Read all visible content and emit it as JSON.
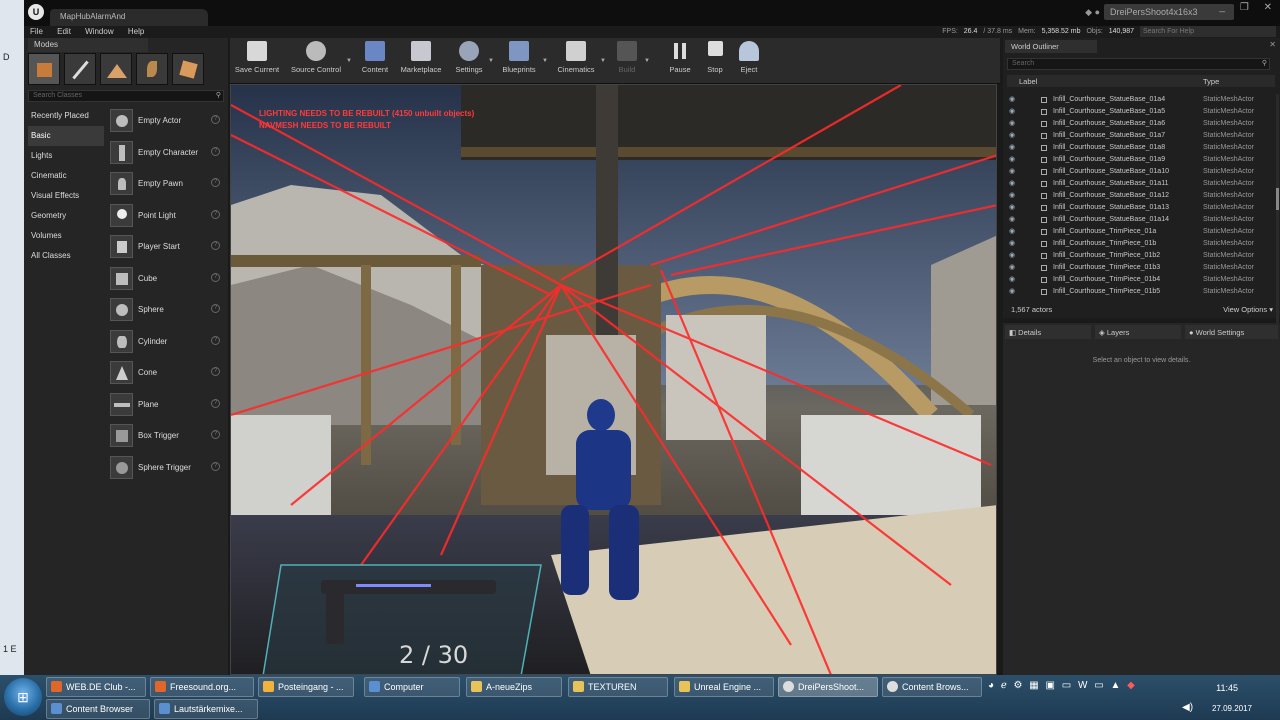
{
  "desktop": {
    "frag_top": "D",
    "frag_bottom": "1 E"
  },
  "window": {
    "logo": "U",
    "map_tab": "MapHubAlarmAnd",
    "project_name": "DreiPersShoot4x16x3",
    "controls": "_ ❐ ✕"
  },
  "menu": {
    "file": "File",
    "edit": "Edit",
    "window": "Window",
    "help": "Help"
  },
  "stats": {
    "fps_label": "FPS:",
    "fps": "26.4",
    "ms": "/ 37.8 ms",
    "mem_label": "Mem:",
    "mem": "5,358.52 mb",
    "objs_label": "Objs:",
    "objs": "140,987",
    "help_search_placeholder": "Search For Help"
  },
  "modes": {
    "tab": "Modes",
    "search_placeholder": "Search Classes",
    "categories": [
      "Recently Placed",
      "Basic",
      "Lights",
      "Cinematic",
      "Visual Effects",
      "Geometry",
      "Volumes",
      "All Classes"
    ],
    "active_category": "Basic",
    "classes": [
      "Empty Actor",
      "Empty Character",
      "Empty Pawn",
      "Point Light",
      "Player Start",
      "Cube",
      "Sphere",
      "Cylinder",
      "Cone",
      "Plane",
      "Box Trigger",
      "Sphere Trigger"
    ]
  },
  "toolbar": {
    "save": "Save Current",
    "source_control": "Source Control",
    "content": "Content",
    "marketplace": "Marketplace",
    "settings": "Settings",
    "blueprints": "Blueprints",
    "cinematics": "Cinematics",
    "build": "Build",
    "pause": "Pause",
    "stop": "Stop",
    "eject": "Eject"
  },
  "viewport": {
    "warning1": "LIGHTING NEEDS TO BE REBUILT (4150 unbuilt objects)",
    "warning2": "NAVMESH NEEDS TO BE REBUILT",
    "ammo": "2 / 30"
  },
  "outliner": {
    "tab": "World Outliner",
    "search_placeholder": "Search",
    "col_label": "Label",
    "col_type": "Type",
    "rows": [
      {
        "name": "Infill_Courthouse_StatueBase_01a4",
        "type": "StaticMeshActor"
      },
      {
        "name": "Infill_Courthouse_StatueBase_01a5",
        "type": "StaticMeshActor"
      },
      {
        "name": "Infill_Courthouse_StatueBase_01a6",
        "type": "StaticMeshActor"
      },
      {
        "name": "Infill_Courthouse_StatueBase_01a7",
        "type": "StaticMeshActor"
      },
      {
        "name": "Infill_Courthouse_StatueBase_01a8",
        "type": "StaticMeshActor"
      },
      {
        "name": "Infill_Courthouse_StatueBase_01a9",
        "type": "StaticMeshActor"
      },
      {
        "name": "Infill_Courthouse_StatueBase_01a10",
        "type": "StaticMeshActor"
      },
      {
        "name": "Infill_Courthouse_StatueBase_01a11",
        "type": "StaticMeshActor"
      },
      {
        "name": "Infill_Courthouse_StatueBase_01a12",
        "type": "StaticMeshActor"
      },
      {
        "name": "Infill_Courthouse_StatueBase_01a13",
        "type": "StaticMeshActor"
      },
      {
        "name": "Infill_Courthouse_StatueBase_01a14",
        "type": "StaticMeshActor"
      },
      {
        "name": "Infill_Courthouse_TrimPiece_01a",
        "type": "StaticMeshActor"
      },
      {
        "name": "Infill_Courthouse_TrimPiece_01b",
        "type": "StaticMeshActor"
      },
      {
        "name": "Infill_Courthouse_TrimPiece_01b2",
        "type": "StaticMeshActor"
      },
      {
        "name": "Infill_Courthouse_TrimPiece_01b3",
        "type": "StaticMeshActor"
      },
      {
        "name": "Infill_Courthouse_TrimPiece_01b4",
        "type": "StaticMeshActor"
      },
      {
        "name": "Infill_Courthouse_TrimPiece_01b5",
        "type": "StaticMeshActor"
      }
    ],
    "actor_count": "1,567 actors",
    "view_options": "View Options ▾"
  },
  "details": {
    "tab_details": "Details",
    "tab_layers": "Layers",
    "tab_world": "World Settings",
    "empty": "Select an object to view details."
  },
  "taskbar": {
    "row1": [
      {
        "label": "WEB.DE Club -...",
        "color": "#e2662a"
      },
      {
        "label": "Freesound.org...",
        "color": "#e2662a"
      },
      {
        "label": "Posteingang - ...",
        "color": "#f2b33d"
      },
      {
        "label": "Computer",
        "color": "#5a8fd0"
      },
      {
        "label": "A-neueZips",
        "color": "#e8c35a"
      },
      {
        "label": "TEXTUREN",
        "color": "#e8c35a"
      },
      {
        "label": "Unreal Engine ...",
        "color": "#e8c35a"
      },
      {
        "label": "DreiPersShoot...",
        "color": "#dddddd"
      },
      {
        "label": "Content Brows...",
        "color": "#dddddd"
      }
    ],
    "row2": [
      {
        "label": "Content Browser",
        "color": "#5a8fd0"
      },
      {
        "label": "Lautstärkemixe...",
        "color": "#5a8fd0"
      }
    ],
    "time": "11:45",
    "date": "27.09.2017"
  },
  "colors": {
    "accent": "#ff3b3b",
    "laser": "#ff2a2a",
    "panel": "#252525"
  }
}
